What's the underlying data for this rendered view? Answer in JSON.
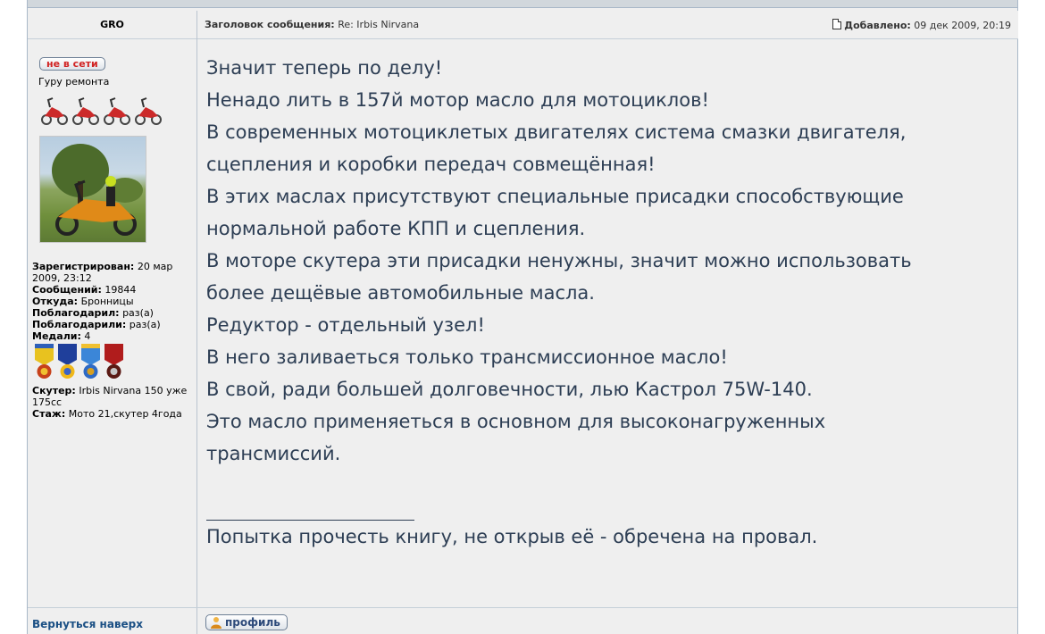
{
  "post_header": {
    "author": "GRO",
    "subject_label": "Заголовок сообщения:",
    "subject": "Re: Irbis Nirvana",
    "added_label": "Добавлено:",
    "added_date": "09 дек 2009, 20:19"
  },
  "profile": {
    "status": "не в сети",
    "rank": "Гуру ремонта",
    "registered_label": "Зарегистрирован:",
    "registered": "20 мар 2009, 23:12",
    "messages_label": "Сообщений:",
    "messages": "19844",
    "from_label": "Откуда:",
    "from": "Бронницы",
    "thanked_label": "Поблагодарил:",
    "thanked": "раз(а)",
    "thanked_by_label": "Поблагодарили:",
    "thanked_by": "раз(а)",
    "medals_label": "Медали:",
    "medals": "4",
    "scooter_label": "Скутер:",
    "scooter": "Irbis Nirvana 150 уже 175сс",
    "experience_label": "Стаж:",
    "experience": "Мото 21,скутер 4года"
  },
  "post_body": {
    "lines": [
      "Значит теперь по делу!",
      "Ненадо лить в 157й мотор масло для мотоциклов!",
      "В современных мотоциклетых двигателях система смазки двигателя,",
      "сцепления и коробки передач совмещённая!",
      "В этих маслах присутствуют специальные присадки способствующие",
      "нормальной работе КПП и сцепления.",
      "В моторе скутера эти присадки ненужны, значит можно использовать",
      "более дещёвые автомобильные масла.",
      "Редуктор - отдельный узел!",
      "В него заливаеться только трансмиссионное масло!",
      "В свой, ради большей долговечности, лью Кастрол 75W-140.",
      "Это масло применяеться в основном для высоконагруженных",
      "трансмиссий."
    ],
    "signature": "Попытка прочесть книгу, не открыв её - обречена на провал."
  },
  "footer": {
    "back_to_top": "Вернуться наверх",
    "profile_button": "профиль"
  },
  "colors": {
    "panel_bg": "#efefef",
    "border": "#a9b8c8",
    "body_text": "#2d3e54",
    "offline_red": "#d12222",
    "link_blue": "#1a4f84"
  }
}
